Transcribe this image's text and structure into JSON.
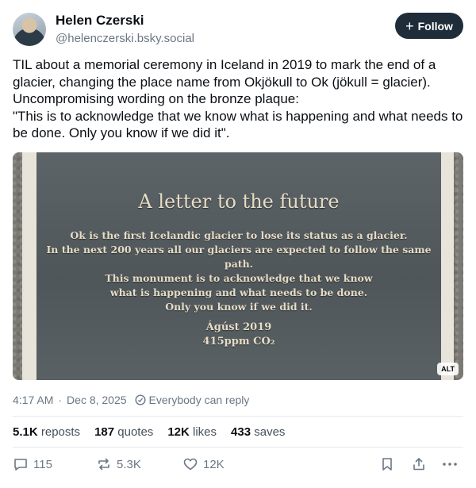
{
  "author": {
    "name": "Helen Czerski",
    "handle": "@helenczerski.bsky.social"
  },
  "follow_button": {
    "plus": "+",
    "label": "Follow"
  },
  "post_text": "TIL about a memorial ceremony in Iceland in 2019 to mark the end of a glacier, changing the place name from Okjökull to Ok (jökull = glacier). Uncompromising wording on the bronze plaque:\n\"This is to acknowledge that we know what is happening and what needs to be done. Only you know if we did it\".",
  "image": {
    "plaque_title": "A letter to the future",
    "plaque_body": "Ok is the first Icelandic glacier to lose its status as a glacier.\nIn the next 200 years all our glaciers are expected to follow the same path.\nThis monument is to acknowledge that we know\nwhat is happening and what needs to be done.\nOnly you know if we did it.",
    "plaque_date": "Ágúst 2019\n415ppm CO₂",
    "alt_badge": "ALT"
  },
  "meta": {
    "time": "4:17 AM",
    "separator": "·",
    "date": "Dec 8, 2025",
    "reply_setting": "Everybody can reply"
  },
  "stats": [
    {
      "count": "5.1K",
      "label": "reposts"
    },
    {
      "count": "187",
      "label": "quotes"
    },
    {
      "count": "12K",
      "label": "likes"
    },
    {
      "count": "433",
      "label": "saves"
    }
  ],
  "actions": {
    "reply_count": "115",
    "repost_count": "5.3K",
    "like_count": "12K"
  },
  "colors": {
    "follow_bg": "#1f2d3a",
    "muted_text": "#6b7785"
  }
}
